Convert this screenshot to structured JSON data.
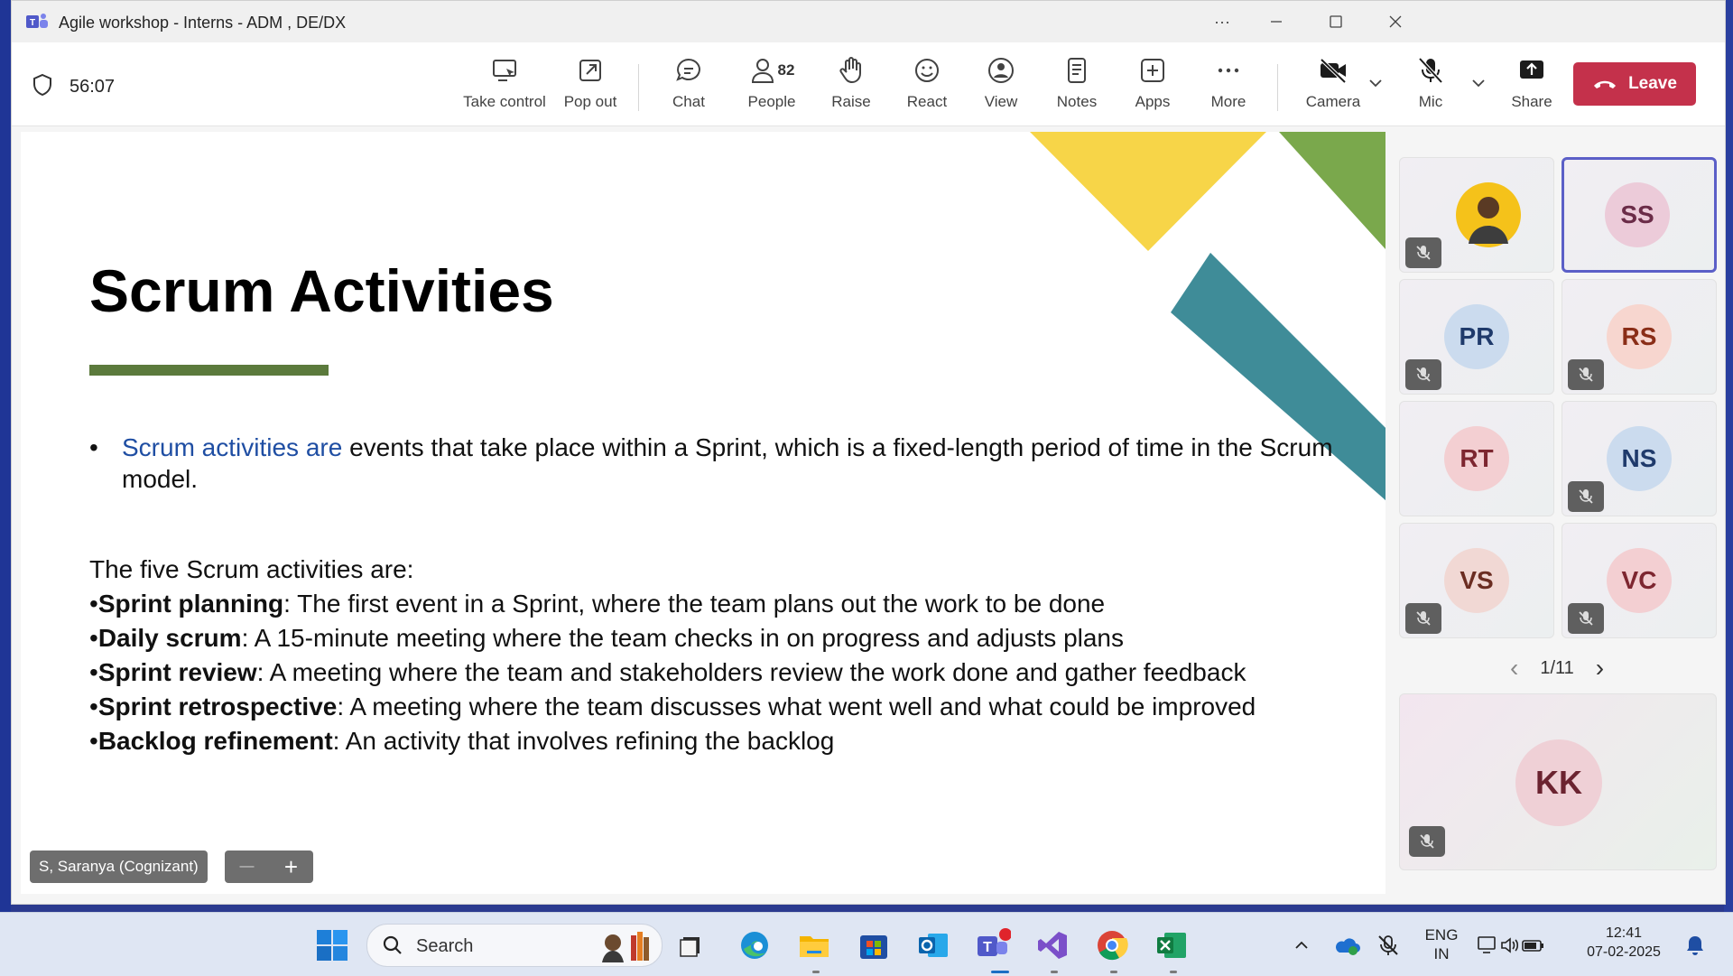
{
  "window": {
    "title": "Agile workshop - Interns - ADM , DE/DX",
    "more_label": "···"
  },
  "toolbar": {
    "timer": "56:07",
    "take_control": "Take control",
    "pop_out": "Pop out",
    "chat": "Chat",
    "people": "People",
    "people_count": "82",
    "raise": "Raise",
    "react": "React",
    "view": "View",
    "notes": "Notes",
    "apps": "Apps",
    "more": "More",
    "camera": "Camera",
    "mic": "Mic",
    "share": "Share",
    "leave": "Leave"
  },
  "slide": {
    "title": "Scrum Activities",
    "bullet_blue": "Scrum activities are",
    "bullet_rest": " events that take place within a Sprint, which is a fixed-length period of time in the Scrum model.",
    "intro": "The five Scrum activities are:",
    "items": [
      {
        "term": "Sprint planning",
        "desc": ": The first event in a Sprint, where the team plans out the work to be done"
      },
      {
        "term": "Daily scrum",
        "desc": ": A 15-minute meeting where the team checks in on progress and adjusts plans"
      },
      {
        "term": "Sprint review",
        "desc": ": A meeting where the team and stakeholders review the work done and gather feedback"
      },
      {
        "term": "Sprint retrospective",
        "desc": ": A meeting where the team discusses what went well and what could be improved"
      },
      {
        "term": "Backlog refinement",
        "desc": ": An activity that involves refining the backlog"
      }
    ],
    "bullet_char": "•",
    "speaker": "S, Saranya (Cognizant)",
    "zoom_out": "—",
    "zoom_in": "+"
  },
  "participants": {
    "tiles": [
      {
        "initials": "",
        "photo": true,
        "muted": true
      },
      {
        "initials": "SS",
        "muted": false,
        "active": true
      },
      {
        "initials": "PR",
        "muted": true
      },
      {
        "initials": "RS",
        "muted": true
      },
      {
        "initials": "RT",
        "muted": false
      },
      {
        "initials": "NS",
        "muted": true
      },
      {
        "initials": "VS",
        "muted": true
      },
      {
        "initials": "VC",
        "muted": true
      }
    ],
    "page": "1/11",
    "prev": "‹",
    "next": "›",
    "self": {
      "initials": "KK",
      "muted": true
    }
  },
  "taskbar": {
    "search_label": "Search",
    "lang_top": "ENG",
    "lang_bottom": "IN",
    "time": "12:41",
    "date": "07-02-2025"
  },
  "colors": {
    "accent": "#5b5fc7",
    "leave": "#c4314b",
    "slide_green": "#5b7a3c",
    "slide_yellow": "#f7d548",
    "slide_teal": "#3f8c98",
    "slide_leaf": "#7aa84c"
  }
}
